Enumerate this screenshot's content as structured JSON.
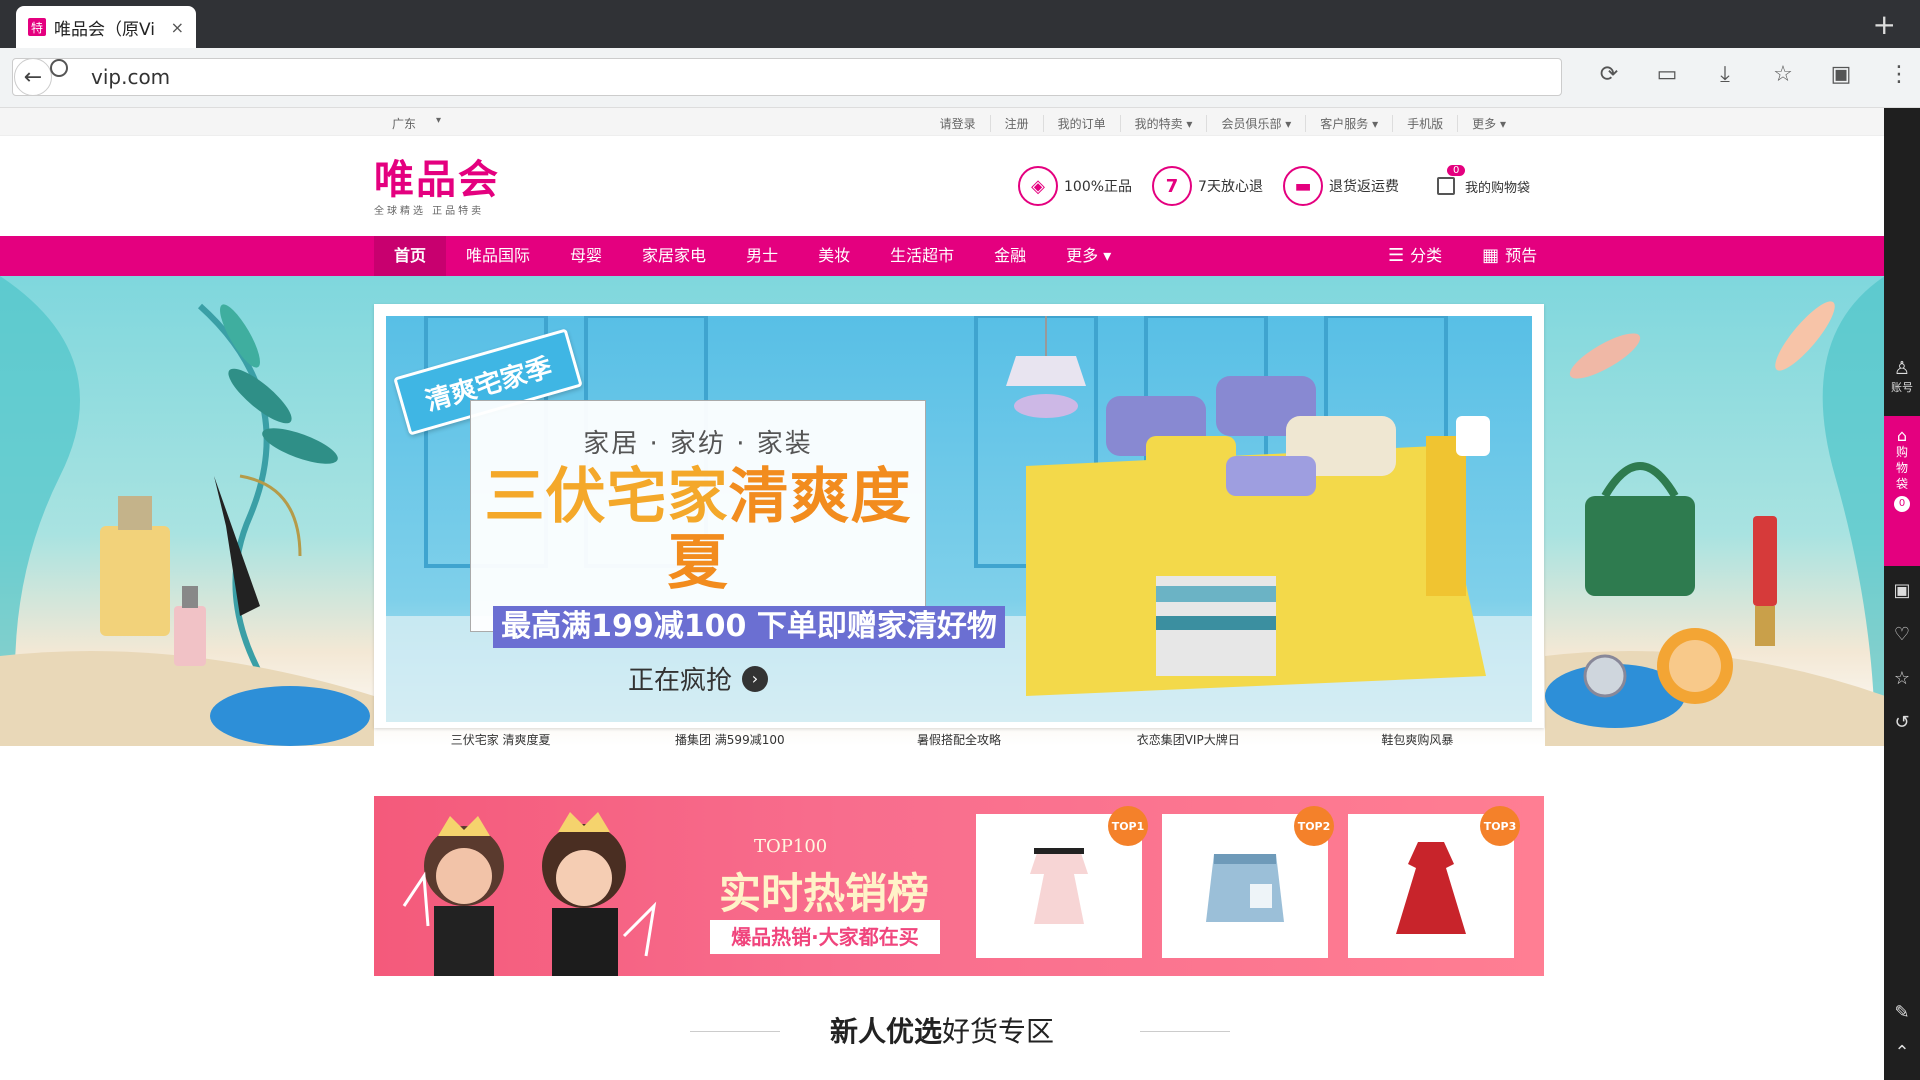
{
  "browser": {
    "tab_title": "唯品会（原Vi",
    "tab_favicon": "特",
    "tab_close": "×",
    "new_tab": "+",
    "url": "vip.com",
    "back_icon": "←",
    "toolbar_icons": [
      "reload-icon",
      "cast-icon",
      "download-icon",
      "star-icon",
      "extension-icon",
      "menu-icon"
    ],
    "toolbar_glyphs": [
      "⟳",
      "▭",
      "⤓",
      "☆",
      "▣",
      "⋮"
    ]
  },
  "site_top": {
    "region": "广东",
    "caret": "▾",
    "links": [
      "请登录",
      "注册",
      "我的订单",
      "我的特卖 ▾",
      "会员俱乐部 ▾",
      "客户服务 ▾",
      "手机版",
      "更多 ▾"
    ]
  },
  "header": {
    "logo": "唯品会",
    "logo_sub": "全球精选 正品特卖",
    "promises": [
      {
        "badge": "◈",
        "label": "100%正品"
      },
      {
        "badge": "7",
        "label": "7天放心退"
      },
      {
        "badge": "▬",
        "label": "退货返运费"
      }
    ],
    "cart_label": "我的购物袋",
    "cart_count": "0"
  },
  "nav": {
    "items": [
      "首页",
      "唯品国际",
      "母婴",
      "家居家电",
      "男士",
      "美妆",
      "生活超市",
      "金融",
      "更多 ▾"
    ],
    "active_index": 0,
    "right": [
      {
        "icon": "☰",
        "label": "分类"
      },
      {
        "icon": "▦",
        "label": "预告"
      }
    ]
  },
  "banner": {
    "season_tag": "清爽宅家季",
    "subtitle": "家居 · 家纺 · 家装",
    "title_plain": "三伏宅家",
    "title_accent": "清爽度夏",
    "offer": "最高满199减100  下单即赠家清好物",
    "cta": "正在疯抢",
    "cta_arrow": "›",
    "tabs": [
      "三伏宅家 清爽度夏",
      "播集团 满599减100",
      "暑假搭配全攻略",
      "衣恋集团VIP大牌日",
      "鞋包爽购风暴"
    ],
    "active_tab": 0
  },
  "top100": {
    "label": "TOP100",
    "title": "实时热销榜",
    "sub": "爆品热销·大家都在买",
    "products": [
      {
        "rank": "TOP1",
        "item": "pink-off-shoulder-dress"
      },
      {
        "rank": "TOP2",
        "item": "denim-skirt"
      },
      {
        "rank": "TOP3",
        "item": "red-dress"
      }
    ]
  },
  "section": {
    "title_bold": "新人优选",
    "title_rest": "好货专区"
  },
  "sidebar": {
    "account": "账号",
    "cart": [
      "购",
      "物",
      "袋"
    ],
    "cart_count": "0"
  },
  "colors": {
    "brand": "#e4007f",
    "nav_active": "#c8006f",
    "offer_bg": "#6b6fd2",
    "title_orange": "#f4a82a"
  }
}
